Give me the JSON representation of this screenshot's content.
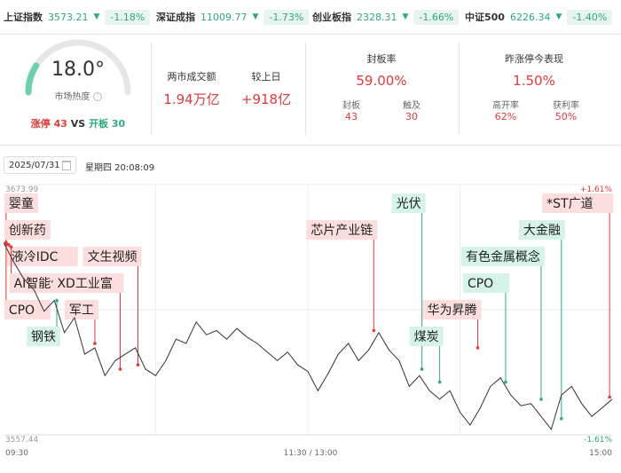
{
  "indices": [
    {
      "name": "上证指数",
      "value": "3573.21",
      "arrow": "▼",
      "change": "-1.18%"
    },
    {
      "name": "深证成指",
      "value": "11009.77",
      "arrow": "▼",
      "change": "-1.73%"
    },
    {
      "name": "创业板指",
      "value": "2328.31",
      "arrow": "▼",
      "change": "-1.66%"
    },
    {
      "name": "中证500",
      "value": "6226.34",
      "arrow": "▼",
      "change": "-1.40%"
    }
  ],
  "heat": {
    "value": "18.0°",
    "label": "市场热度",
    "level": 0.18
  },
  "limits": {
    "up_label": "涨停",
    "up_count": "43",
    "vs": "VS",
    "open_label": "开板",
    "open_count": "30"
  },
  "turnover": {
    "label": "两市成交额",
    "value": "1.94万亿",
    "prev_label": "较上日",
    "prev_value": "+918亿"
  },
  "seal": {
    "label": "封板率",
    "value": "59.00%",
    "sub1_label": "封板",
    "sub1_value": "43",
    "sub2_label": "触及",
    "sub2_value": "30"
  },
  "yesterday": {
    "label": "昨涨停今表现",
    "value": "1.50%",
    "sub1_label": "高开率",
    "sub1_value": "62%",
    "sub2_label": "获利率",
    "sub2_value": "50%"
  },
  "date": {
    "value": "2025/07/31",
    "time": "星期四 20:08:09"
  },
  "chart_data": {
    "type": "line",
    "y_max": "3673.99",
    "y_min": "3557.44",
    "y_max_pct": "+1.61%",
    "y_min_pct": "-1.61%",
    "ylim": [
      3557.44,
      3673.99
    ],
    "x_labels": [
      "09:30",
      "11:30 / 13:00",
      "15:00"
    ],
    "x_range": [
      0,
      240
    ],
    "grid": true,
    "series": [
      {
        "x": [
          0,
          4,
          8,
          12,
          16,
          20,
          24,
          28,
          32,
          36,
          40,
          44,
          48,
          52,
          56,
          60,
          64,
          68,
          72,
          76,
          80,
          84,
          88,
          92,
          96,
          100,
          104,
          108,
          112,
          116,
          120,
          124,
          128,
          132,
          136,
          140,
          144,
          148,
          152,
          156,
          160,
          164,
          168,
          172,
          176,
          180,
          184,
          188,
          192,
          196,
          200,
          204,
          208,
          212,
          216,
          220,
          224,
          228,
          232,
          236,
          240
        ],
        "y": [
          3647,
          3638,
          3630,
          3625,
          3615,
          3620,
          3605,
          3612,
          3595,
          3598,
          3585,
          3592,
          3595,
          3598,
          3588,
          3585,
          3592,
          3602,
          3600,
          3610,
          3604,
          3606,
          3602,
          3607,
          3603,
          3600,
          3596,
          3592,
          3596,
          3590,
          3587,
          3578,
          3586,
          3595,
          3600,
          3592,
          3597,
          3605,
          3597,
          3592,
          3580,
          3585,
          3578,
          3574,
          3578,
          3568,
          3562,
          3570,
          3580,
          3584,
          3576,
          3571,
          3572,
          3566,
          3560,
          3576,
          3580,
          3572,
          3566,
          3570,
          3574
        ]
      }
    ],
    "annotations": [
      {
        "label": "婴童",
        "time": "09:31",
        "value": 3647
      },
      {
        "label": "创新药",
        "time": "09:31",
        "value": 3647
      },
      {
        "label": "液冷IDC",
        "time": "09:32",
        "value": 3646
      },
      {
        "label": "AI智能体",
        "time": "09:33",
        "value": 3645
      },
      {
        "label": "CPO",
        "time": "09:31",
        "value": 3646
      },
      {
        "label": "钢铁",
        "time": "09:51",
        "value": 3620
      },
      {
        "label": "军工",
        "time": "10:06",
        "value": 3600
      },
      {
        "label": "XD工业富",
        "time": "10:16",
        "value": 3588
      },
      {
        "label": "文生视频",
        "time": "10:23",
        "value": 3590
      },
      {
        "label": "芯片产业链",
        "time": "13:26",
        "value": 3606
      },
      {
        "label": "光伏",
        "time": "13:45",
        "value": 3588
      },
      {
        "label": "煤炭",
        "time": "13:52",
        "value": 3582
      },
      {
        "label": "华为昇腾",
        "time": "14:07",
        "value": 3598
      },
      {
        "label": "CPO",
        "time": "14:18",
        "value": 3582
      },
      {
        "label": "有色金属概念",
        "time": "14:32",
        "value": 3574
      },
      {
        "label": "大金融",
        "time": "14:40",
        "value": 3565
      },
      {
        "label": "*ST广道",
        "time": "14:59",
        "value": 3575
      }
    ]
  },
  "colors": {
    "up": "#e03a3a",
    "down": "#2fa87e",
    "up_tag_bg": "#fcdede",
    "down_tag_bg": "#d5f3e8",
    "gauge_fill": "#6cd0b0",
    "gauge_track": "#e6e6e6"
  }
}
